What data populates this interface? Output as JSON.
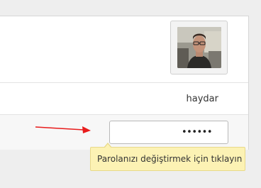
{
  "profile": {
    "username": "haydar",
    "password_masked": "••••••"
  },
  "tooltip": {
    "text": "Parolanızı değiştirmek için tıklayın"
  },
  "annotation": {
    "arrow_color": "#e81c1c"
  },
  "colors": {
    "tooltip_bg": "#fcf2b4",
    "page_bg": "#eeeeee"
  }
}
